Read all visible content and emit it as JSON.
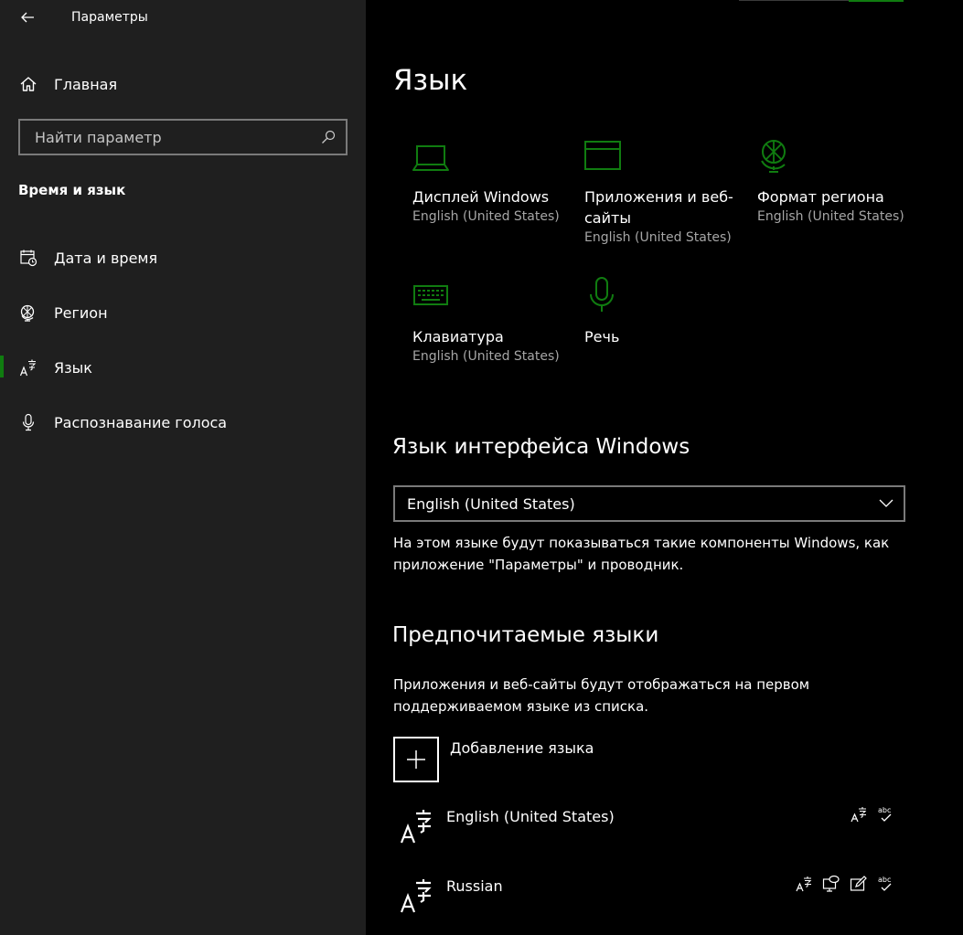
{
  "app": {
    "title": "Параметры"
  },
  "sidebar": {
    "home_label": "Главная",
    "search_placeholder": "Найти параметр",
    "section_label": "Время и язык",
    "items": [
      {
        "label": "Дата и время",
        "icon": "calendar-clock-icon"
      },
      {
        "label": "Регион",
        "icon": "globe-icon"
      },
      {
        "label": "Язык",
        "icon": "language-icon",
        "active": true
      },
      {
        "label": "Распознавание голоса",
        "icon": "microphone-icon"
      }
    ]
  },
  "main": {
    "title": "Язык",
    "tiles": [
      {
        "title": "Дисплей Windows",
        "sub": "English (United States)",
        "icon": "laptop-icon"
      },
      {
        "title": "Приложения и веб-сайты",
        "sub": "English (United States)",
        "icon": "app-window-icon"
      },
      {
        "title": "Формат региона",
        "sub": "English (United States)",
        "icon": "globe-format-icon"
      },
      {
        "title": "Клавиатура",
        "sub": "English (United States)",
        "icon": "keyboard-icon"
      },
      {
        "title": "Речь",
        "sub": "",
        "icon": "microphone-icon"
      }
    ],
    "display_language": {
      "heading": "Язык интерфейса Windows",
      "selected": "English (United States)",
      "description": "На этом языке будут показываться такие компоненты Windows, как приложение \"Параметры\" и проводник."
    },
    "preferred": {
      "heading": "Предпочитаемые языки",
      "description": "Приложения и веб-сайты будут отображаться на первом поддерживаемом языке из списка.",
      "add_label": "Добавление языка",
      "languages": [
        {
          "name": "English (United States)",
          "features": [
            "display-language-icon",
            "spellcheck-icon"
          ]
        },
        {
          "name": "Russian",
          "features": [
            "display-language-icon",
            "speech-icon",
            "handwriting-icon",
            "spellcheck-icon"
          ]
        }
      ]
    }
  },
  "colors": {
    "accent": "#107c10",
    "sidebar_bg": "#1f1f1f",
    "main_bg": "#000000",
    "secondary_text": "#a6a6a6"
  }
}
